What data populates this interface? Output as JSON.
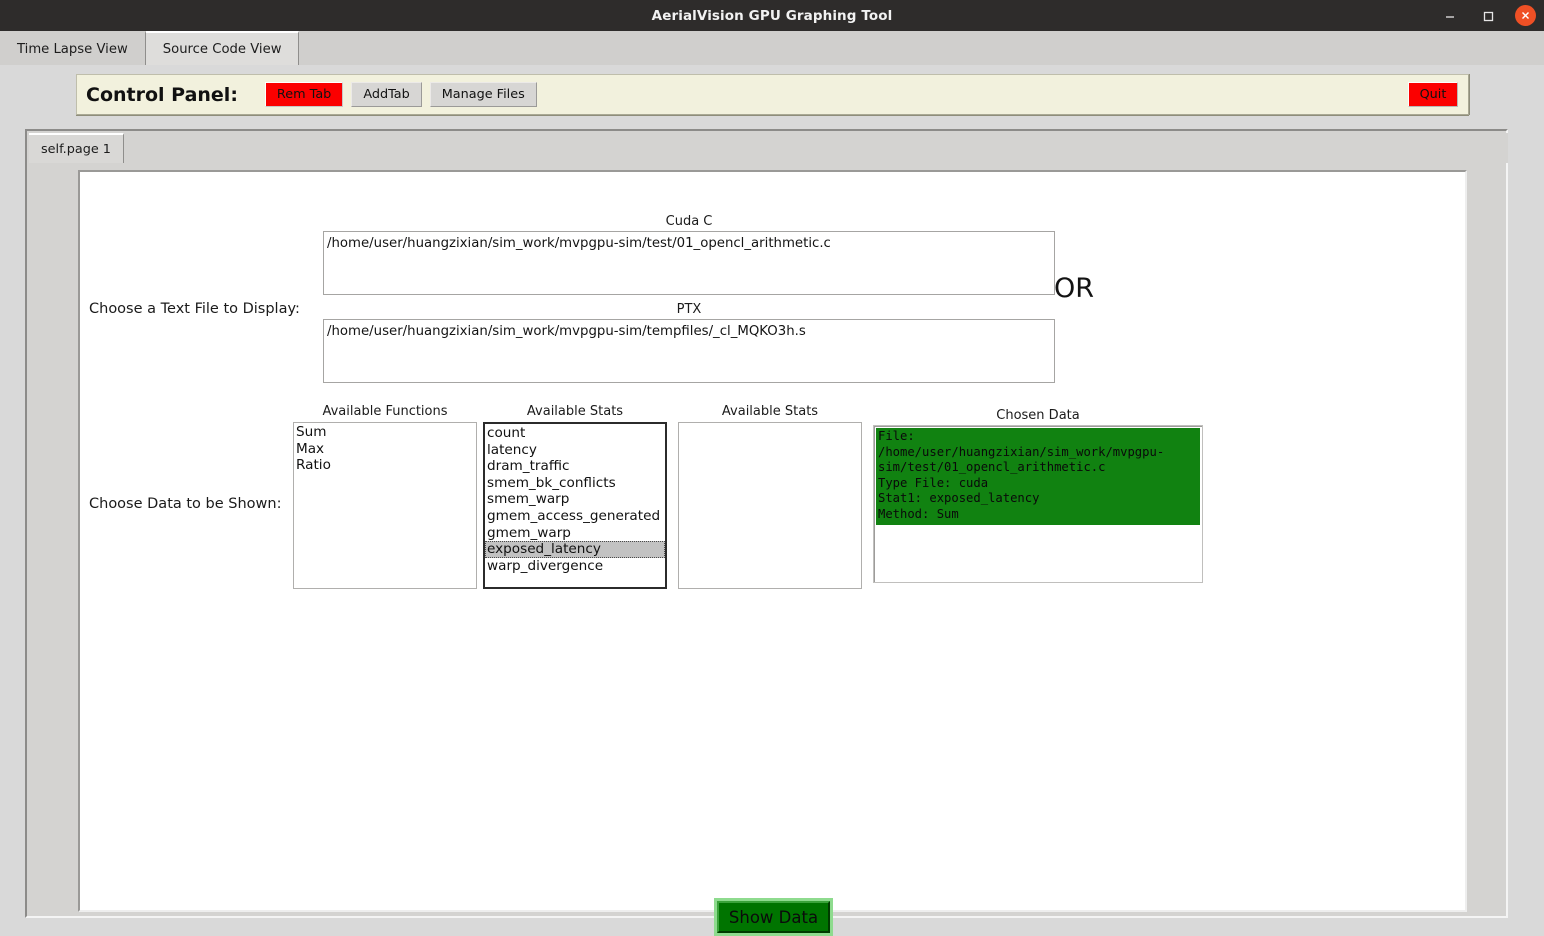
{
  "window": {
    "title": "AerialVision GPU Graphing Tool",
    "controls": {
      "minimize": "minimize-icon",
      "maximize": "maximize-icon",
      "close": "close-icon"
    }
  },
  "main_tabs": [
    {
      "label": "Time Lapse View",
      "active": false
    },
    {
      "label": "Source Code View",
      "active": true
    }
  ],
  "control_panel": {
    "title": "Control Panel:",
    "buttons": [
      {
        "label": "Rem Tab",
        "color": "#fb0000"
      },
      {
        "label": "AddTab",
        "color": "#d7d6d4"
      },
      {
        "label": "Manage Files",
        "color": "#d7d6d4"
      }
    ],
    "quit_label": "Quit",
    "quit_color": "#fb0000",
    "background": "#f2f1dd"
  },
  "page_tabs": [
    {
      "label": "self.page 1",
      "active": true
    }
  ],
  "content": {
    "file_section_label": "Choose a Text File to Display:",
    "data_section_label": "Choose Data to be Shown:",
    "or_label": "OR",
    "cuda_caption": "Cuda C",
    "cuda_path": "/home/user/huangzixian/sim_work/mvpgpu-sim/test/01_opencl_arithmetic.c",
    "ptx_caption": "PTX",
    "ptx_path": "/home/user/huangzixian/sim_work/mvpgpu-sim/tempfiles/_cl_MQKO3h.s",
    "functions_caption": "Available Functions",
    "functions": [
      "Sum",
      "Max",
      "Ratio"
    ],
    "stats1_caption": "Available Stats",
    "stats1": [
      "count",
      "latency",
      "dram_traffic",
      "smem_bk_conflicts",
      "smem_warp",
      "gmem_access_generated",
      "gmem_warp",
      "exposed_latency",
      "warp_divergence"
    ],
    "stats1_selected": "exposed_latency",
    "stats2_caption": "Available Stats",
    "stats2": [],
    "chosen_caption": "Chosen Data",
    "chosen_entry": "File: /home/user/huangzixian/sim_work/mvpgpu-sim/test/01_opencl_arithmetic.c\nType File: cuda\nStat1: exposed_latency\nMethod: Sum",
    "chosen_entry_color": "#118211",
    "show_data_label": "Show Data",
    "show_data_color": "#007400"
  }
}
